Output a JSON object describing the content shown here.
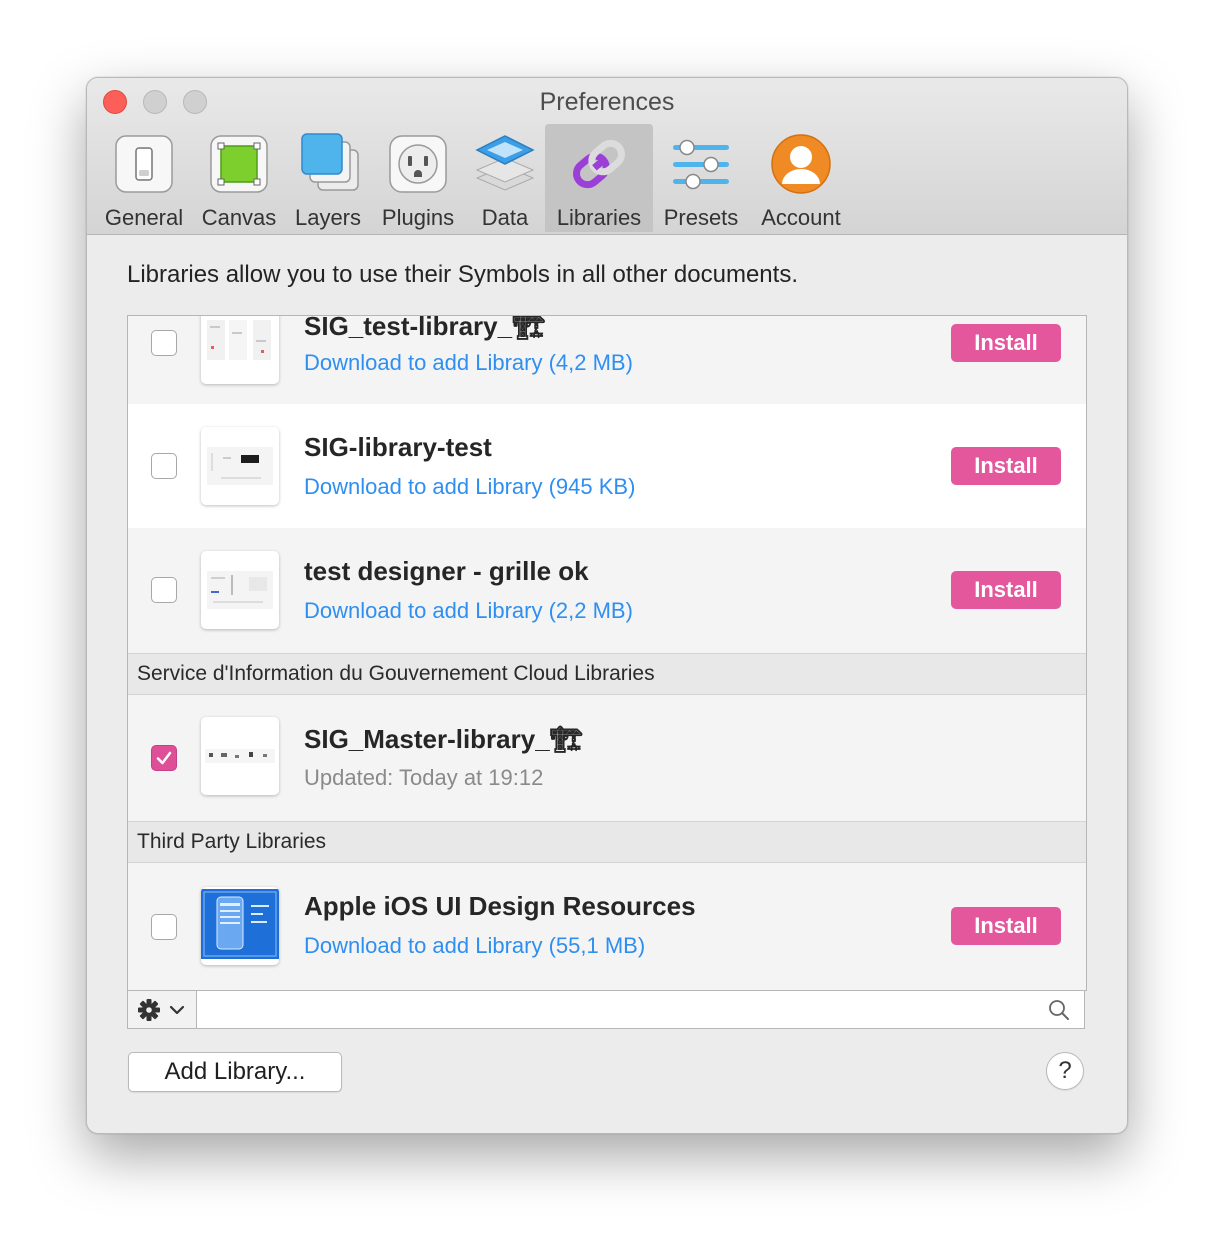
{
  "window": {
    "title": "Preferences"
  },
  "toolbar": {
    "items": [
      {
        "label": "General",
        "icon": "general-switch-icon"
      },
      {
        "label": "Canvas",
        "icon": "canvas-icon"
      },
      {
        "label": "Layers",
        "icon": "layers-icon"
      },
      {
        "label": "Plugins",
        "icon": "plugin-outlet-icon"
      },
      {
        "label": "Data",
        "icon": "data-stack-icon"
      },
      {
        "label": "Libraries",
        "icon": "libraries-link-icon",
        "selected": true
      },
      {
        "label": "Presets",
        "icon": "presets-sliders-icon"
      },
      {
        "label": "Account",
        "icon": "account-avatar-icon"
      }
    ]
  },
  "intro_text": "Libraries allow you to use their Symbols in all other documents.",
  "libraries": [
    {
      "name": "SIG_test-library_🏗",
      "subtitle": "Download to add Library (4,2 MB)",
      "install_label": "Install",
      "checked": false
    },
    {
      "name": "SIG-library-test",
      "subtitle": "Download to add Library (945 KB)",
      "install_label": "Install",
      "checked": false
    },
    {
      "name": "test designer - grille ok",
      "subtitle": "Download to add Library (2,2 MB)",
      "install_label": "Install",
      "checked": false
    }
  ],
  "cloud_section": {
    "header": "Service d'Information du Gouvernement Cloud Libraries",
    "item": {
      "name": "SIG_Master-library_🏗",
      "subtitle": "Updated: Today at 19:12",
      "checked": true
    }
  },
  "third_party_section": {
    "header": "Third Party Libraries",
    "item": {
      "name": "Apple iOS UI Design Resources",
      "subtitle": "Download to add Library (55,1 MB)",
      "install_label": "Install",
      "checked": false
    }
  },
  "search": {
    "placeholder": ""
  },
  "footer": {
    "add_library_label": "Add Library...",
    "help_label": "?"
  },
  "colors": {
    "install_button": "#e4579c",
    "link_blue": "#2f8ff0",
    "checkbox_checked": "#de4f97",
    "close_button": "#fc5f57"
  }
}
